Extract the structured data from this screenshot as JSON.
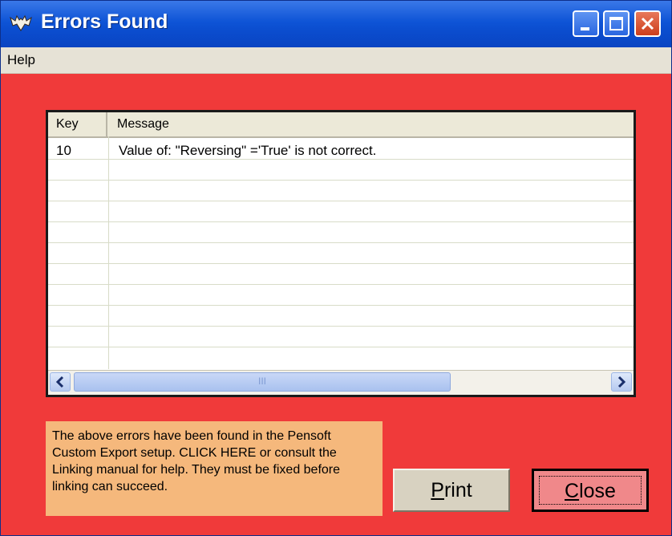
{
  "window": {
    "title": "Errors Found",
    "title_icon": "bat-app-icon",
    "controls": [
      "minimize-icon",
      "maximize-icon",
      "close-icon"
    ]
  },
  "menu": {
    "items": [
      "Help"
    ]
  },
  "grid": {
    "columns": [
      "Key",
      "Message"
    ],
    "rows": [
      {
        "key": "10",
        "message": "Value of: \"Reversing\" ='True' is not correct."
      }
    ],
    "scroll_grip": "III"
  },
  "notice": {
    "text": "The above errors have been found in the Pensoft Custom Export setup.  CLICK HERE or consult the Linking manual for help.  They must be fixed before linking can succeed."
  },
  "buttons": {
    "print": "Print",
    "close": "Close"
  },
  "colors": {
    "window_bg": "#f03a3a",
    "titlebar": "#0b4ed0",
    "notice_bg": "#f5b87c",
    "close_button": "#f0888a"
  }
}
